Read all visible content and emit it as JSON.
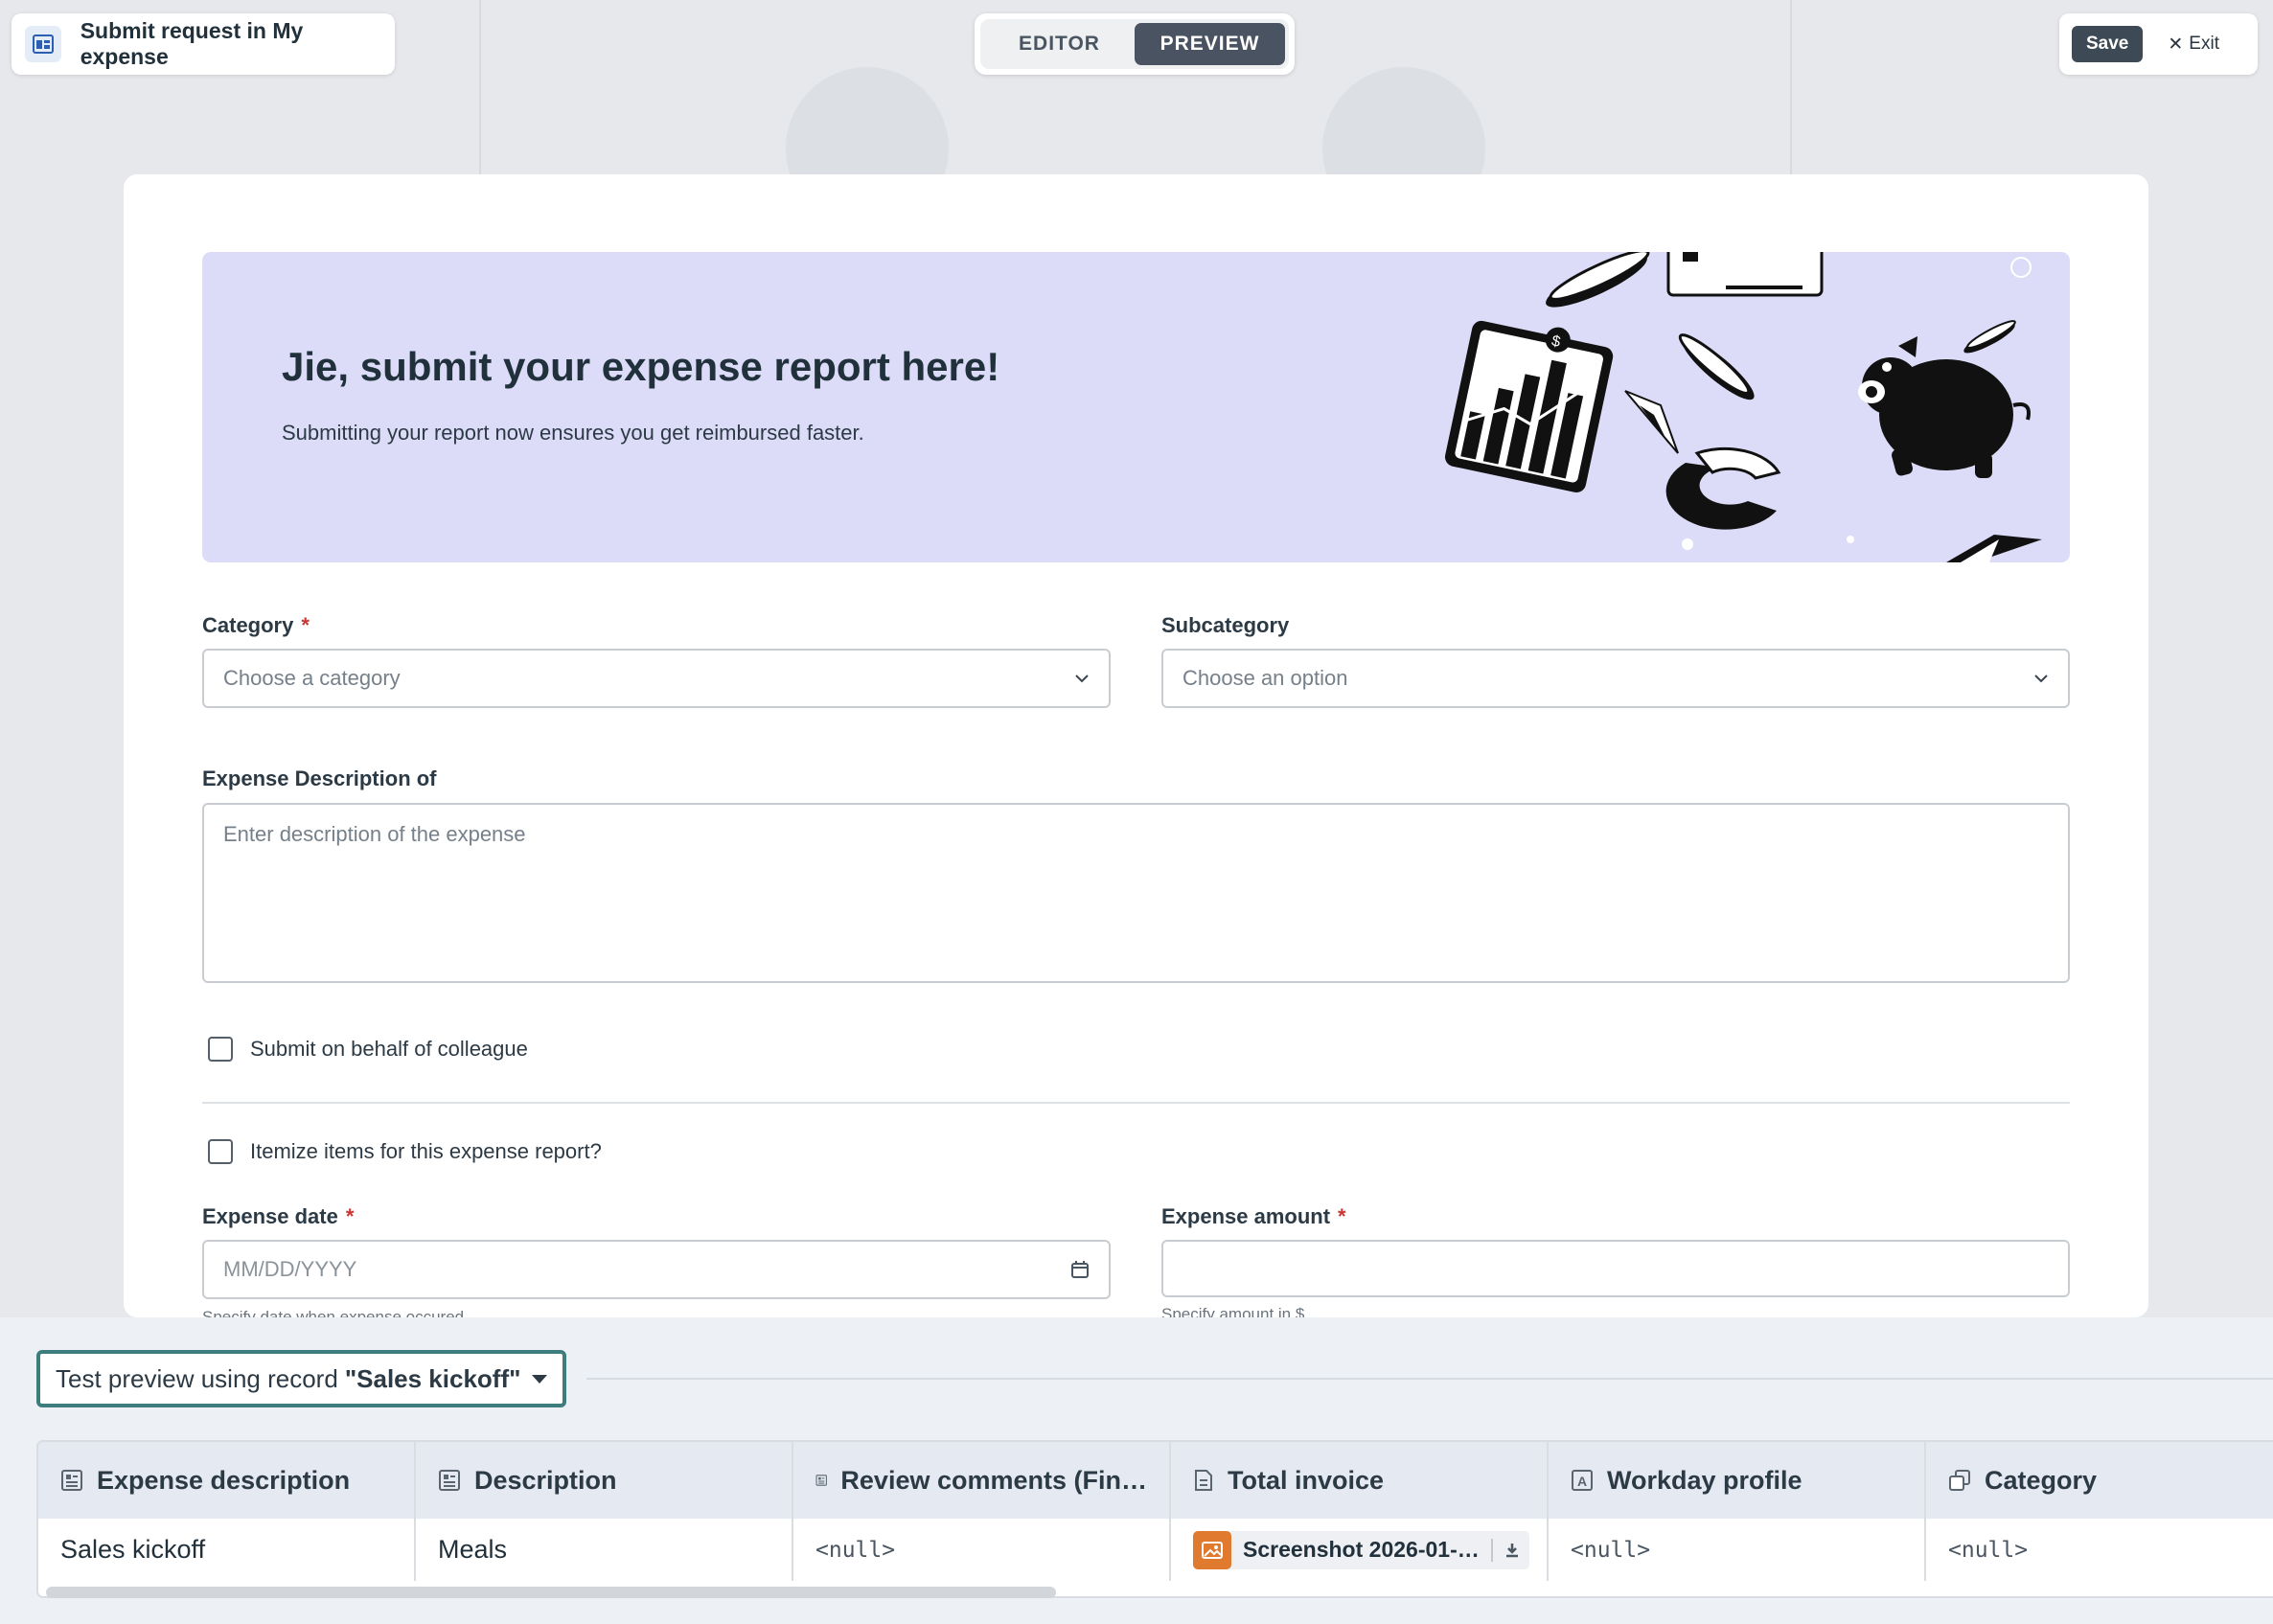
{
  "header": {
    "title": "Submit request in My expense",
    "app_icon": "form-layout-icon",
    "modes": [
      "EDITOR",
      "PREVIEW"
    ],
    "active_mode": "PREVIEW",
    "save_label": "Save",
    "exit_label": "Exit"
  },
  "banner": {
    "title": "Jie, submit your expense report here!",
    "subtitle": "Submitting your report now ensures you get reimbursed faster.",
    "background": "#dcdcf8"
  },
  "form": {
    "category": {
      "label": "Category",
      "required": "*",
      "placeholder": "Choose a category"
    },
    "subcategory": {
      "label": "Subcategory",
      "placeholder": "Choose an option"
    },
    "description": {
      "label": "Expense Description of",
      "placeholder": "Enter description of the expense"
    },
    "behalf_checkbox": {
      "label": "Submit on behalf of colleague",
      "checked": false
    },
    "itemize_checkbox": {
      "label": "Itemize items for this expense report?",
      "checked": false
    },
    "expense_date": {
      "label": "Expense date",
      "required": "*",
      "placeholder": "MM/DD/YYYY",
      "helper": "Specify date when expense occured"
    },
    "expense_amount": {
      "label": "Expense amount",
      "required": "*",
      "helper": "Specify amount in $"
    }
  },
  "preview": {
    "prefix": "Test preview using record",
    "record": "\"Sales kickoff\"",
    "columns": [
      {
        "label": "Expense description",
        "icon": "text-field-icon"
      },
      {
        "label": "Description",
        "icon": "text-field-icon"
      },
      {
        "label": "Review comments (Fin…",
        "icon": "text-field-icon"
      },
      {
        "label": "Total invoice",
        "icon": "document-icon"
      },
      {
        "label": "Workday profile",
        "icon": "link-field-icon"
      },
      {
        "label": "Category",
        "icon": "reference-icon"
      }
    ],
    "row": {
      "expense_description": "Sales kickoff",
      "description": "Meals",
      "review_comments": "<null>",
      "total_invoice_file": "Screenshot 2026-01-…",
      "workday_profile": "<null>",
      "category": "<null>"
    }
  },
  "colors": {
    "accent_dark": "#4a5361",
    "record_border": "#3d7d7e",
    "file_thumb": "#e07a2f",
    "required": "#cc3333"
  }
}
